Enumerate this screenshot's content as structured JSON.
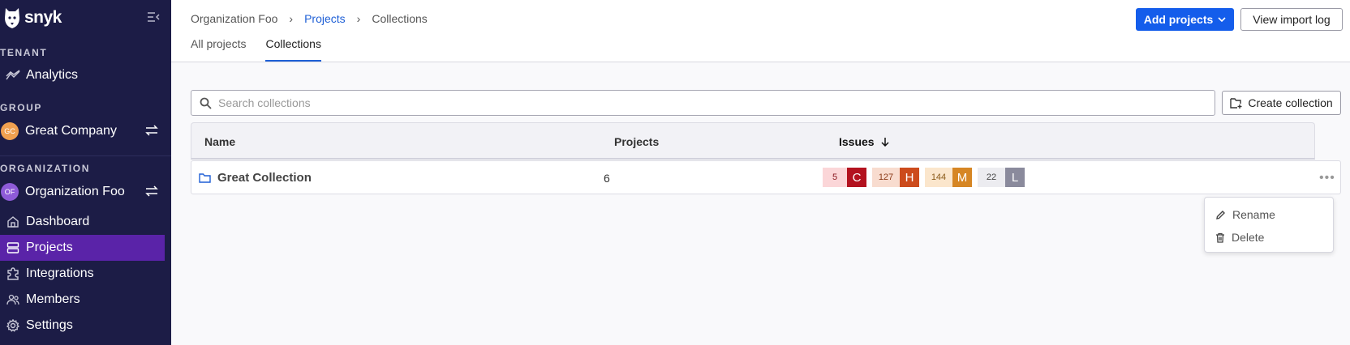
{
  "brand": {
    "name": "snyk"
  },
  "sidebar": {
    "tenant_label": "TENANT",
    "analytics_label": "Analytics",
    "group_label": "GROUP",
    "group": {
      "name": "Great Company",
      "initials": "GC",
      "color": "#f0a050"
    },
    "org_label": "ORGANIZATION",
    "org": {
      "name": "Organization Foo",
      "initials": "OF",
      "color": "#8e5bd8"
    },
    "items": [
      {
        "label": "Dashboard",
        "icon": "home-icon"
      },
      {
        "label": "Projects",
        "icon": "projects-icon",
        "active": true
      },
      {
        "label": "Integrations",
        "icon": "puzzle-icon"
      },
      {
        "label": "Members",
        "icon": "members-icon"
      },
      {
        "label": "Settings",
        "icon": "gear-icon"
      }
    ]
  },
  "header": {
    "breadcrumb": [
      "Organization Foo",
      "Projects",
      "Collections"
    ],
    "tabs": [
      "All projects",
      "Collections"
    ],
    "add_projects": "Add projects",
    "view_import_log": "View import log"
  },
  "search": {
    "placeholder": "Search collections",
    "value": ""
  },
  "create_collection": "Create collection",
  "table": {
    "columns": [
      "Name",
      "Projects",
      "Issues"
    ],
    "rows": [
      {
        "name": "Great Collection",
        "projects": "6",
        "issues": {
          "critical": {
            "count": "5",
            "letter": "C"
          },
          "high": {
            "count": "127",
            "letter": "H"
          },
          "medium": {
            "count": "144",
            "letter": "M"
          },
          "low": {
            "count": "22",
            "letter": "L"
          }
        }
      }
    ]
  },
  "menu": {
    "rename": "Rename",
    "delete": "Delete"
  },
  "colors": {
    "sidebar_bg": "#1c1c46",
    "active_nav": "#5a23a8",
    "primary_button": "#145deb",
    "critical": "#b3121f",
    "high": "#cc4b1c",
    "medium": "#d68624",
    "low": "#8a8a9c"
  }
}
